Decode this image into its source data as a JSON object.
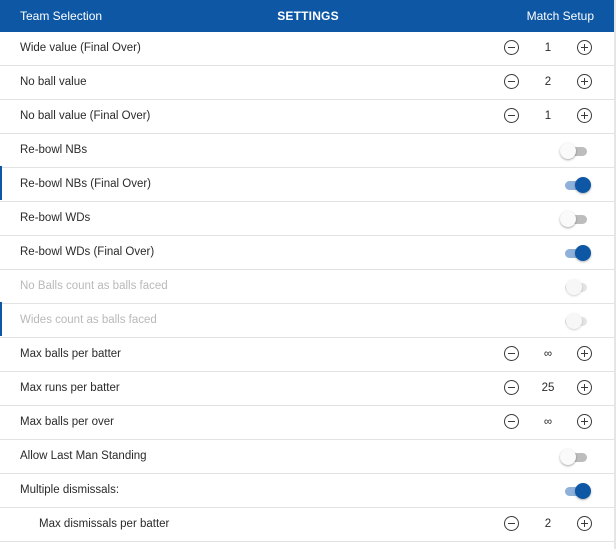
{
  "header": {
    "left": "Team Selection",
    "title": "SETTINGS",
    "right": "Match Setup"
  },
  "rows": [
    {
      "label": "Wide value (Final Over)",
      "type": "stepper",
      "value": "1"
    },
    {
      "label": "No ball value",
      "type": "stepper",
      "value": "2"
    },
    {
      "label": "No ball value (Final Over)",
      "type": "stepper",
      "value": "1"
    },
    {
      "label": "Re-bowl NBs",
      "type": "toggle",
      "on": false
    },
    {
      "label": "Re-bowl NBs (Final Over)",
      "type": "toggle",
      "on": true
    },
    {
      "label": "Re-bowl WDs",
      "type": "toggle",
      "on": false
    },
    {
      "label": "Re-bowl WDs (Final Over)",
      "type": "toggle",
      "on": true
    },
    {
      "label": "No Balls count as balls faced",
      "type": "toggle",
      "on": false,
      "disabled": true
    },
    {
      "label": "Wides count as balls faced",
      "type": "toggle",
      "on": false,
      "disabled": true
    },
    {
      "label": "Max balls per batter",
      "type": "stepper",
      "value": "∞"
    },
    {
      "label": "Max runs per batter",
      "type": "stepper",
      "value": "25"
    },
    {
      "label": "Max balls per over",
      "type": "stepper",
      "value": "∞"
    },
    {
      "label": "Allow Last Man Standing",
      "type": "toggle",
      "on": false
    },
    {
      "label": "Multiple dismissals:",
      "type": "toggle",
      "on": true
    },
    {
      "label": "Max dismissals per batter",
      "type": "stepper",
      "value": "2",
      "indent": true
    }
  ]
}
